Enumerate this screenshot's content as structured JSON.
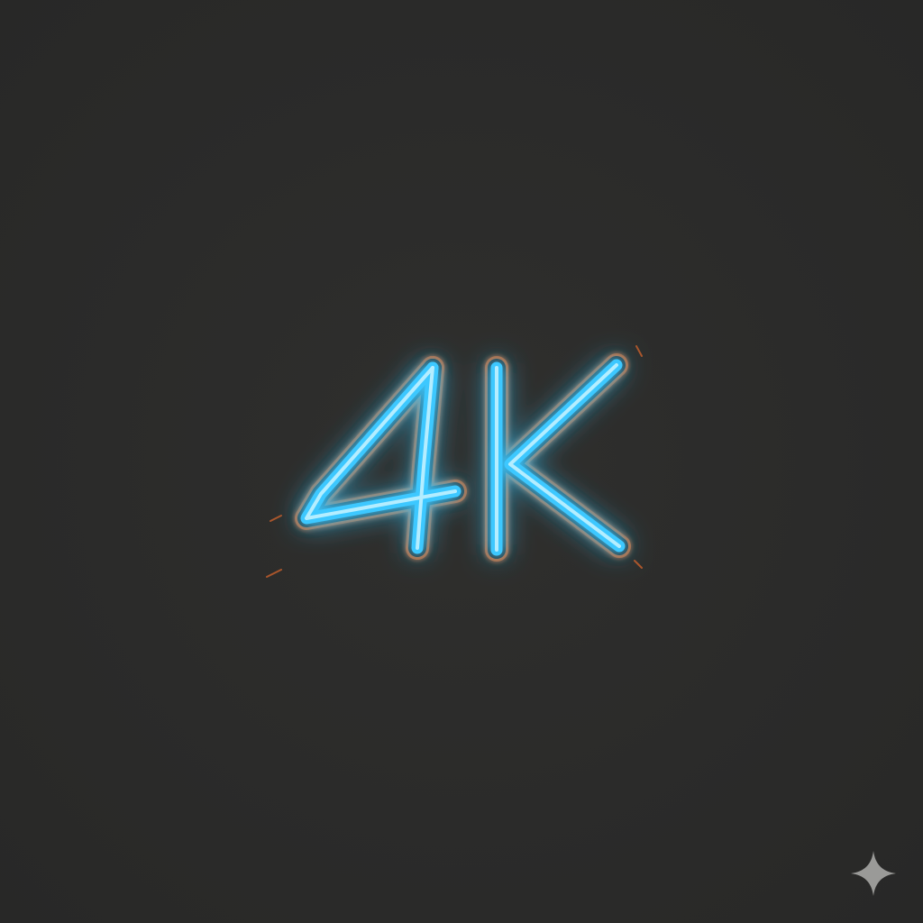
{
  "sign": {
    "text": "4K",
    "tube_color": "#3ec8ff",
    "tube_core_color": "#c9f4ff",
    "outline_color": "#d8672e",
    "background_color": "#2b2b2a"
  },
  "icons": {
    "sparkle": "sparkle-icon"
  }
}
